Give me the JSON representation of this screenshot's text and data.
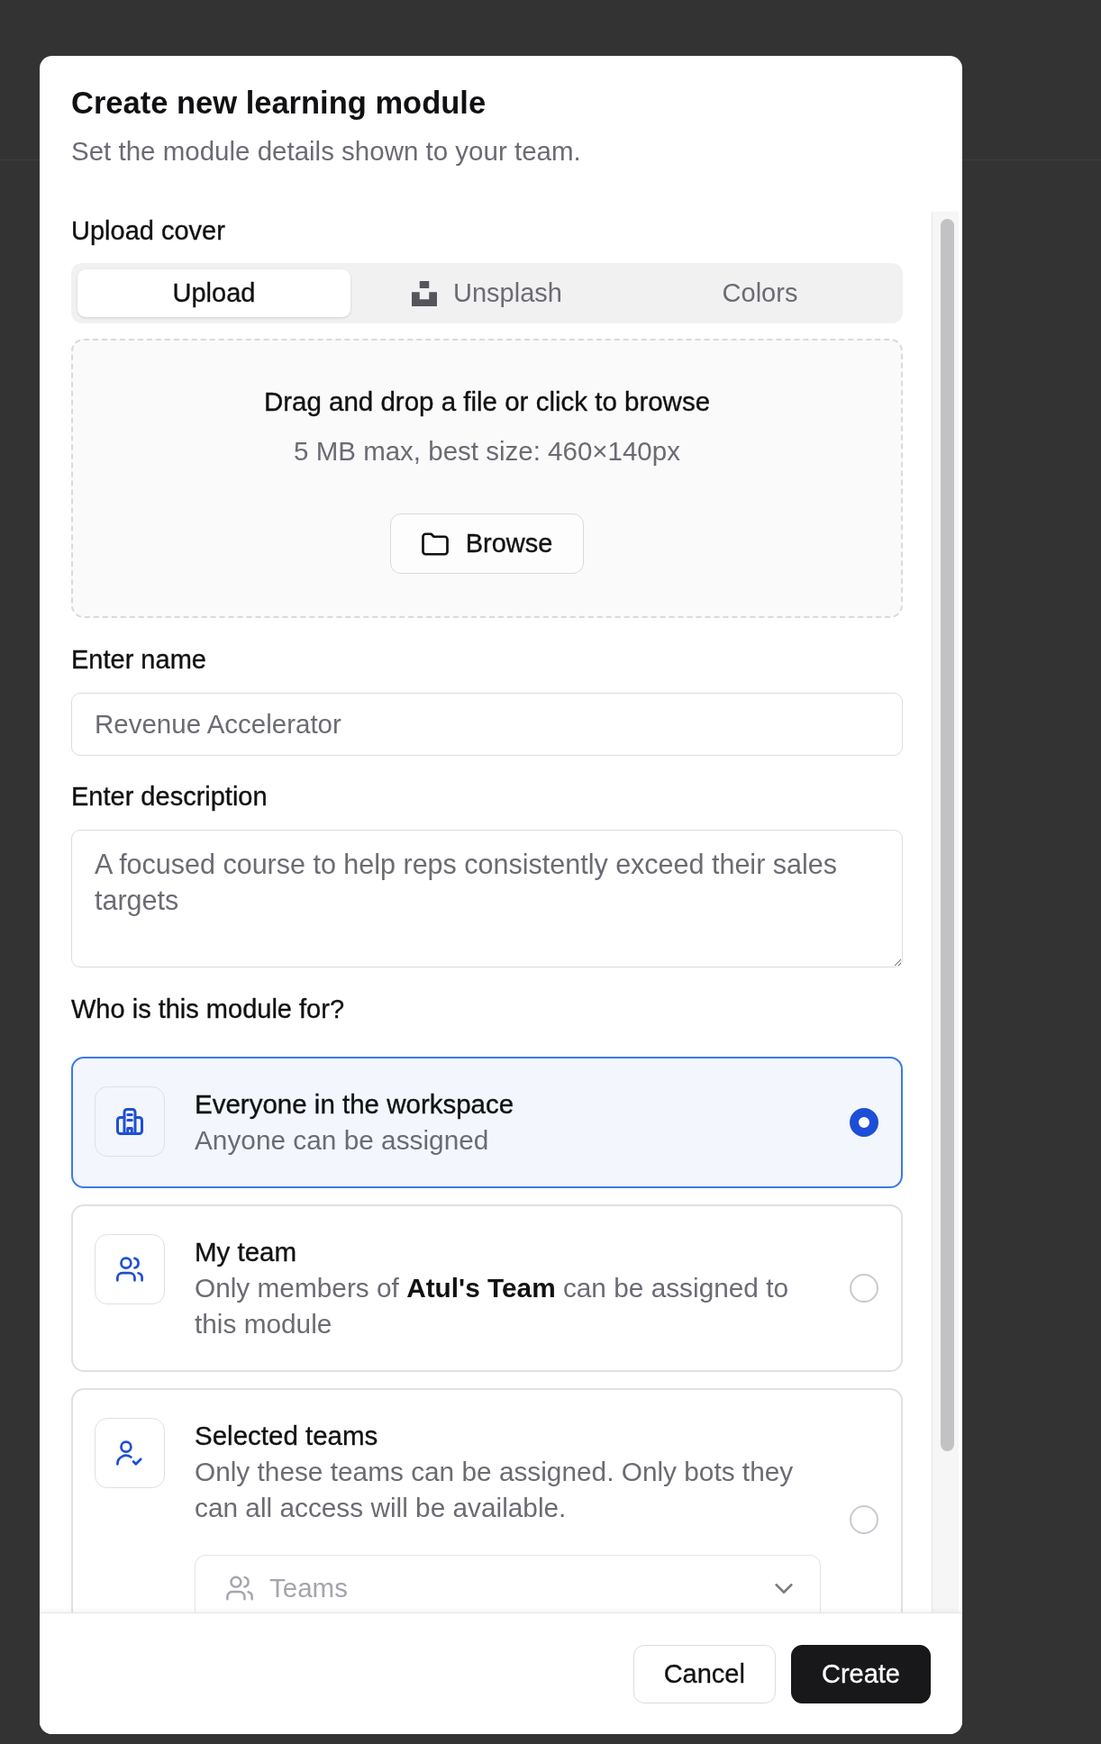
{
  "dialog": {
    "title": "Create new learning module",
    "subtitle": "Set the module details shown to your team."
  },
  "cover": {
    "label": "Upload cover",
    "tabs": [
      {
        "label": "Upload",
        "selected": true,
        "kind": "plain"
      },
      {
        "label": "Unsplash",
        "selected": false,
        "kind": "logo"
      },
      {
        "label": "Colors",
        "selected": false,
        "kind": "plain"
      }
    ],
    "dropzone": {
      "title": "Drag and drop a file or click to browse",
      "hint": "5 MB max, best size: 460×140px",
      "button": "Browse"
    }
  },
  "name_field": {
    "label": "Enter name",
    "placeholder": "Revenue Accelerator"
  },
  "description_field": {
    "label": "Enter description",
    "placeholder": "A focused course to help reps consistently exceed their sales targets"
  },
  "audience": {
    "label": "Who is this module for?",
    "options": [
      {
        "kind": "workspace",
        "title": "Everyone in the workspace",
        "description": "Anyone can be assigned",
        "selected": true
      },
      {
        "kind": "team",
        "title": "My team",
        "description": "Only members of **Atul's Team** can be assigned to this module",
        "selected": false
      },
      {
        "kind": "teams",
        "title": "Selected teams",
        "description": "Only these teams can be assigned. Only bots they can all access will be available.",
        "selected": false,
        "teams_select": {
          "placeholder": "Teams"
        }
      }
    ]
  },
  "footer": {
    "buttons": [
      {
        "label": "Cancel",
        "kind": "cancel"
      },
      {
        "label": "Create",
        "kind": "submit"
      }
    ]
  }
}
